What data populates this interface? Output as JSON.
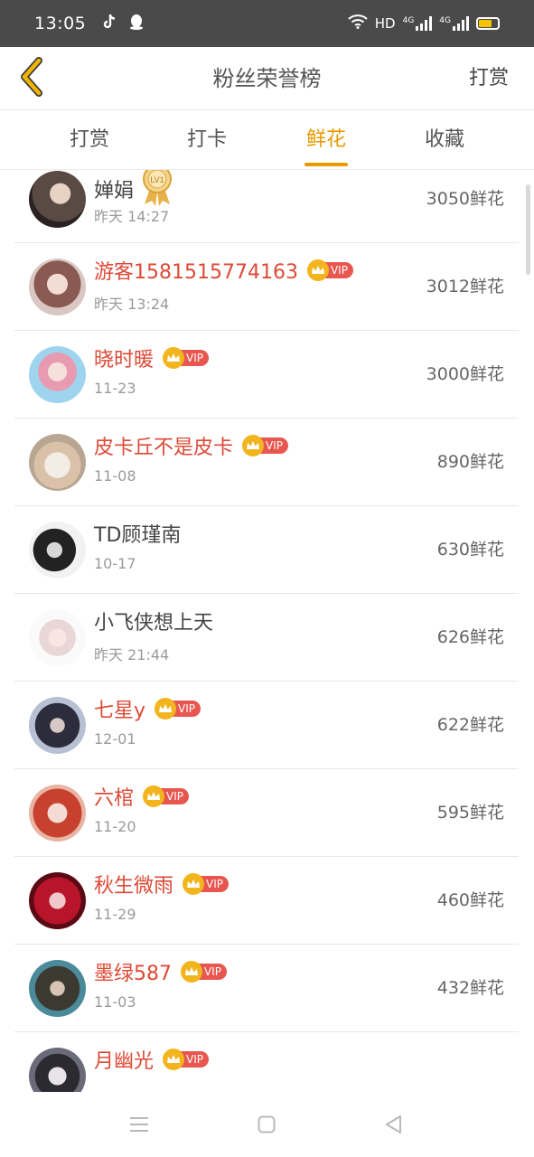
{
  "status_bar": {
    "time": "13:05",
    "network": "HD",
    "signal_1": "4G",
    "signal_2": "4G",
    "icons": [
      "tiktok-icon",
      "qq-icon",
      "wifi-icon",
      "signal-icon",
      "battery-icon"
    ],
    "battery_color": "#f5c400"
  },
  "header": {
    "title": "粉丝荣誉榜",
    "right_action": "打赏",
    "back_icon": "chevron-left-icon",
    "back_color": "#e8a800"
  },
  "tabs": [
    {
      "label": "打赏",
      "active": false
    },
    {
      "label": "打卡",
      "active": false
    },
    {
      "label": "鲜花",
      "active": true
    },
    {
      "label": "收藏",
      "active": false
    }
  ],
  "accent_color": "#e89a00",
  "vip_label": "VIP",
  "level_badge_label": "LV1",
  "fans": [
    {
      "name": "婵娟",
      "time": "昨天 14:27",
      "amount": "3050鲜花",
      "vip": false,
      "level_badge": true
    },
    {
      "name": "游客1581515774163",
      "time": "昨天 13:24",
      "amount": "3012鲜花",
      "vip": true
    },
    {
      "name": "晓时暖",
      "time": "11-23",
      "amount": "3000鲜花",
      "vip": true
    },
    {
      "name": "皮卡丘不是皮卡",
      "time": "11-08",
      "amount": "890鲜花",
      "vip": true
    },
    {
      "name": "TD顾瑾南",
      "time": "10-17",
      "amount": "630鲜花",
      "vip": false
    },
    {
      "name": "小飞侠想上天",
      "time": "昨天 21:44",
      "amount": "626鲜花",
      "vip": false
    },
    {
      "name": "七星y",
      "time": "12-01",
      "amount": "622鲜花",
      "vip": true
    },
    {
      "name": "六棺",
      "time": "11-20",
      "amount": "595鲜花",
      "vip": true
    },
    {
      "name": "秋生微雨",
      "time": "11-29",
      "amount": "460鲜花",
      "vip": true
    },
    {
      "name": "墨绿587",
      "time": "11-03",
      "amount": "432鲜花",
      "vip": true
    },
    {
      "name": "月幽光",
      "time": "",
      "amount": "",
      "vip": true
    }
  ],
  "nav": [
    "menu-icon",
    "home-icon",
    "back-icon"
  ]
}
